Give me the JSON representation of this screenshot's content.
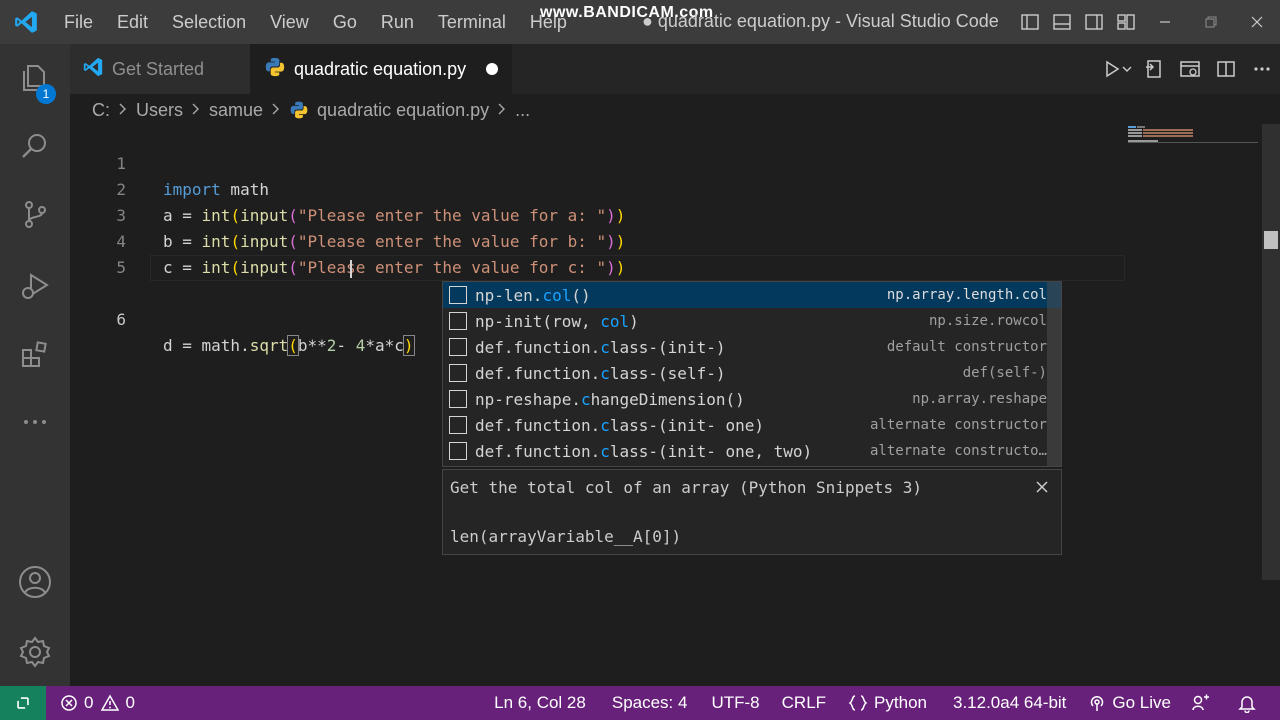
{
  "titlebar": {
    "menu": [
      "File",
      "Edit",
      "Selection",
      "View",
      "Go",
      "Run",
      "Terminal",
      "Help"
    ],
    "watermark": "www.BANDICAM.com",
    "window_title": "● quadratic equation.py - Visual Studio Code"
  },
  "activitybar": {
    "explorer_badge": "1"
  },
  "tabs": [
    {
      "label": "Get Started",
      "active": false
    },
    {
      "label": "quadratic equation.py",
      "active": true,
      "dirty": true
    }
  ],
  "breadcrumb": {
    "drive": "C:",
    "folder1": "Users",
    "folder2": "samue",
    "file": "quadratic equation.py",
    "more": "..."
  },
  "editor": {
    "lines": [
      {
        "num": "1",
        "text": "import math"
      },
      {
        "num": "2",
        "text": "a = int(input(\"Please enter the value for a: \"))"
      },
      {
        "num": "3",
        "text": "b = int(input(\"Please enter the value for b: \"))"
      },
      {
        "num": "4",
        "text": "c = int(input(\"Please enter the value for c: \"))"
      },
      {
        "num": "5",
        "text": ""
      },
      {
        "num": "6",
        "text": "d = math.sqrt(b**2- 4*a*c)"
      }
    ]
  },
  "suggest": {
    "items": [
      {
        "pre": "np-len.",
        "hl": "col",
        "post": "()",
        "detail": "np.array.length.col",
        "selected": true
      },
      {
        "pre": "np-init(row, ",
        "hl": "col",
        "post": ")",
        "detail": "np.size.rowcol",
        "selected": false
      },
      {
        "pre": "def.function.",
        "hl": "c",
        "post": "lass-(init-)",
        "detail": "default constructor",
        "selected": false
      },
      {
        "pre": "def.function.",
        "hl": "c",
        "post": "lass-(self-)",
        "detail": "def(self-)",
        "selected": false
      },
      {
        "pre": "np-reshape.",
        "hl": "c",
        "post": "hangeDimension()",
        "detail": "np.array.reshape",
        "selected": false
      },
      {
        "pre": "def.function.",
        "hl": "c",
        "post": "lass-(init- one)",
        "detail": "alternate constructor",
        "selected": false
      },
      {
        "pre": "def.function.",
        "hl": "c",
        "post": "lass-(init- one, two)",
        "detail": "alternate constructo…",
        "selected": false
      }
    ],
    "details_title": "Get the total col of an array (Python Snippets 3)",
    "details_code": "len(arrayVariable__A[0])"
  },
  "statusbar": {
    "errors": "0",
    "warnings": "0",
    "position": "Ln 6, Col 28",
    "spaces": "Spaces: 4",
    "encoding": "UTF-8",
    "eol": "CRLF",
    "language": "Python",
    "interpreter": "3.12.0a4 64-bit",
    "golive": "Go Live"
  },
  "colors": {
    "statusbar": "#68217a",
    "remote": "#16825d",
    "accent": "#0078d4",
    "activitybar": "#333333",
    "titlebar": "#3c3c3c"
  }
}
